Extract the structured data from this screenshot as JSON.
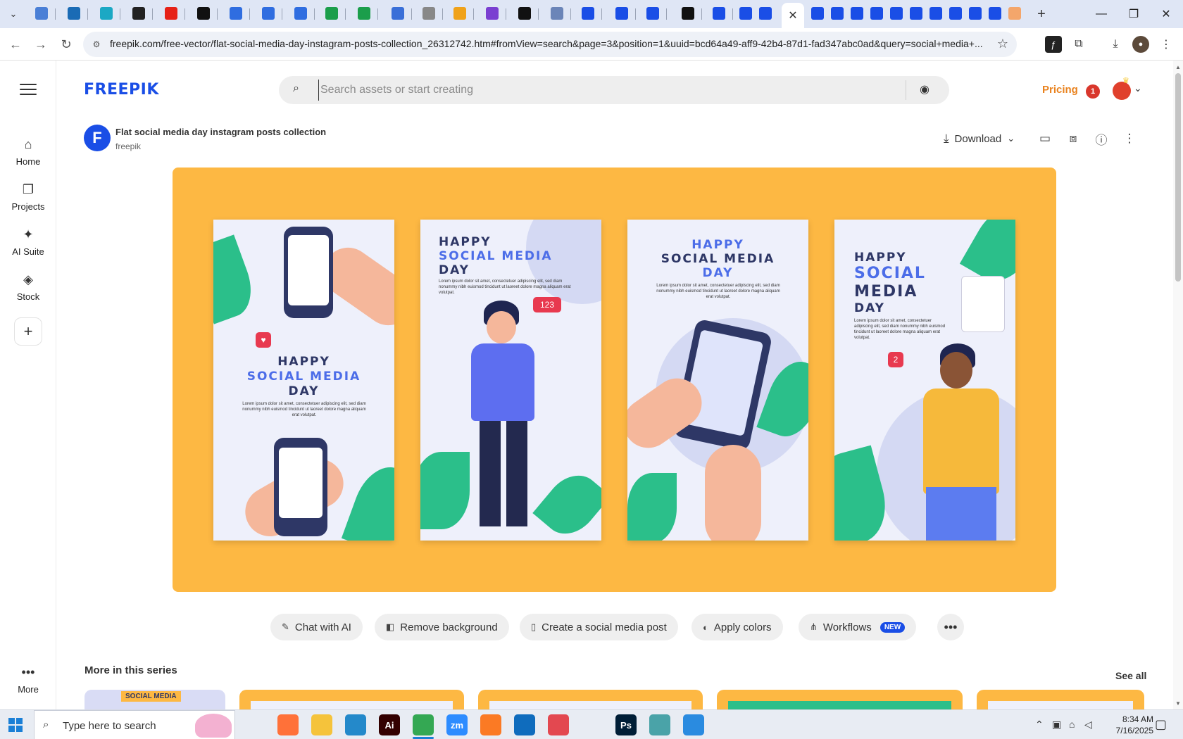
{
  "browser": {
    "tabs": [
      {
        "icon": "chevron-down-icon"
      },
      {
        "icon": "globe-icon",
        "color": "#4a7fd6"
      },
      {
        "icon": "vpn-icon",
        "color": "#1a6bb5"
      },
      {
        "icon": "diamond-icon",
        "color": "#1ba8c4"
      },
      {
        "icon": "openai-icon",
        "color": "#222222"
      },
      {
        "icon": "youtube-icon",
        "color": "#e62117"
      },
      {
        "icon": "bolt-icon",
        "color": "#111111"
      },
      {
        "icon": "docs-icon",
        "color": "#2f6de0"
      },
      {
        "icon": "docs-icon",
        "color": "#2f6de0"
      },
      {
        "icon": "docs-icon",
        "color": "#2f6de0"
      },
      {
        "icon": "sheets-icon",
        "color": "#1b9e4b"
      },
      {
        "icon": "sheets-icon",
        "color": "#1b9e4b"
      },
      {
        "icon": "mu-icon",
        "color": "#3a6fd8"
      },
      {
        "icon": "globe-icon",
        "color": "#888888"
      },
      {
        "icon": "crown-icon",
        "color": "#f0a21a"
      },
      {
        "icon": "braces-icon",
        "color": "#7a3fd1"
      },
      {
        "icon": "lambda-icon",
        "color": "#111111"
      },
      {
        "icon": "b-icon",
        "color": "#6b85b8"
      },
      {
        "icon": "freepik-icon",
        "color": "#1a4ee6"
      },
      {
        "icon": "freepik-icon",
        "color": "#1a4ee6"
      },
      {
        "icon": "freepik-icon",
        "color": "#1a4ee6"
      },
      {
        "icon": "m-icon",
        "color": "#111111"
      },
      {
        "icon": "freepik-icon",
        "color": "#1a4ee6"
      },
      {
        "icon": "freepik-icon",
        "color": "#1a4ee6"
      },
      {
        "icon": "freepik-icon",
        "color": "#1a4ee6"
      }
    ],
    "active_tab_close": "✕",
    "tabs_right": [
      {
        "icon": "freepik-icon",
        "color": "#1a4ee6"
      },
      {
        "icon": "freepik-icon",
        "color": "#1a4ee6"
      },
      {
        "icon": "freepik-icon",
        "color": "#1a4ee6"
      },
      {
        "icon": "freepik-icon",
        "color": "#1a4ee6"
      },
      {
        "icon": "freepik-icon",
        "color": "#1a4ee6"
      },
      {
        "icon": "freepik-icon",
        "color": "#1a4ee6"
      },
      {
        "icon": "freepik-icon",
        "color": "#1a4ee6"
      },
      {
        "icon": "freepik-icon",
        "color": "#1a4ee6"
      },
      {
        "icon": "freepik-icon",
        "color": "#1a4ee6"
      },
      {
        "icon": "freepik-icon",
        "color": "#1a4ee6"
      },
      {
        "icon": "illustration-icon",
        "color": "#f4a66b"
      }
    ],
    "new_tab": "+",
    "window_controls": {
      "minimize": "—",
      "restore": "❐",
      "close": "✕"
    },
    "url": "freepik.com/free-vector/flat-social-media-day-instagram-posts-collection_26312742.htm#fromView=search&page=3&position=1&uuid=bcd64a49-aff9-42b4-87d1-fad347abc0ad&query=social+media+..."
  },
  "header": {
    "logo": "FREEPIK",
    "search_placeholder": "Search assets or start creating",
    "pricing": "Pricing",
    "notification_count": "1"
  },
  "sidebar": {
    "items": [
      {
        "label": "Home",
        "icon": "home-icon"
      },
      {
        "label": "Projects",
        "icon": "projects-icon"
      },
      {
        "label": "AI Suite",
        "icon": "sparkle-icon"
      },
      {
        "label": "Stock",
        "icon": "stock-icon"
      }
    ],
    "add": "+",
    "more": "More",
    "more_icon": "•••"
  },
  "resource": {
    "title": "Flat social media day instagram posts collection",
    "author": "freepik",
    "author_initial": "F",
    "download": "Download",
    "preview_bg": "#fdb843",
    "posts": [
      {
        "line1": "HAPPY",
        "line2": "SOCIAL MEDIA",
        "line3": "DAY"
      },
      {
        "line1": "HAPPY",
        "line2": "SOCIAL MEDIA",
        "line3": "DAY",
        "badge": "123"
      },
      {
        "line1": "HAPPY",
        "line2": "SOCIAL MEDIA",
        "line3": "DAY"
      },
      {
        "line1": "HAPPY",
        "line2": "SOCIAL",
        "line3": "MEDIA",
        "line4": "DAY",
        "badge": "2"
      }
    ],
    "lorem": "Lorem ipsum dolor sit amet, consectetuer adipiscing elit, sed diam nonummy nibh euismod tincidunt ut laoreet dolore magna aliquam erat volutpat."
  },
  "actions": {
    "chips": [
      {
        "label": "Chat with AI",
        "icon": "chat-ai-icon"
      },
      {
        "label": "Remove background",
        "icon": "remove-bg-icon"
      },
      {
        "label": "Create a social media post",
        "icon": "phone-icon"
      },
      {
        "label": "Apply colors",
        "icon": "palette-icon"
      },
      {
        "label": "Workflows",
        "icon": "workflow-icon",
        "badge": "NEW"
      }
    ],
    "more": "•••"
  },
  "series": {
    "title": "More in this series",
    "see_all": "See all",
    "thumb_text": "SOCIAL MEDIA"
  },
  "taskbar": {
    "search_placeholder": "Type here to search",
    "apps": [
      {
        "icon": "task-view-icon",
        "color": "#e8ecf3"
      },
      {
        "icon": "firefox-icon",
        "color": "#ff7139"
      },
      {
        "icon": "file-explorer-icon",
        "color": "#f5c33b"
      },
      {
        "icon": "vscode-icon",
        "color": "#2489ca"
      },
      {
        "icon": "illustrator-icon",
        "color": "#330000",
        "label": "Ai"
      },
      {
        "icon": "chrome-icon",
        "color": "#34a853"
      },
      {
        "icon": "zoom-icon",
        "color": "#2d8cff",
        "label": "zm"
      },
      {
        "icon": "xampp-icon",
        "color": "#fb7a24"
      },
      {
        "icon": "outlook-icon",
        "color": "#0f6cbd"
      },
      {
        "icon": "creative-cloud-icon",
        "color": "#e34850"
      },
      {
        "icon": "pen-tool-icon",
        "color": "#e8ecf3"
      },
      {
        "icon": "photoshop-icon",
        "color": "#001e36",
        "label": "Ps"
      },
      {
        "icon": "cube-icon",
        "color": "#4aa3a8"
      },
      {
        "icon": "photos-icon",
        "color": "#2a8be0"
      }
    ],
    "time": "8:34 AM",
    "date": "7/16/2025"
  }
}
